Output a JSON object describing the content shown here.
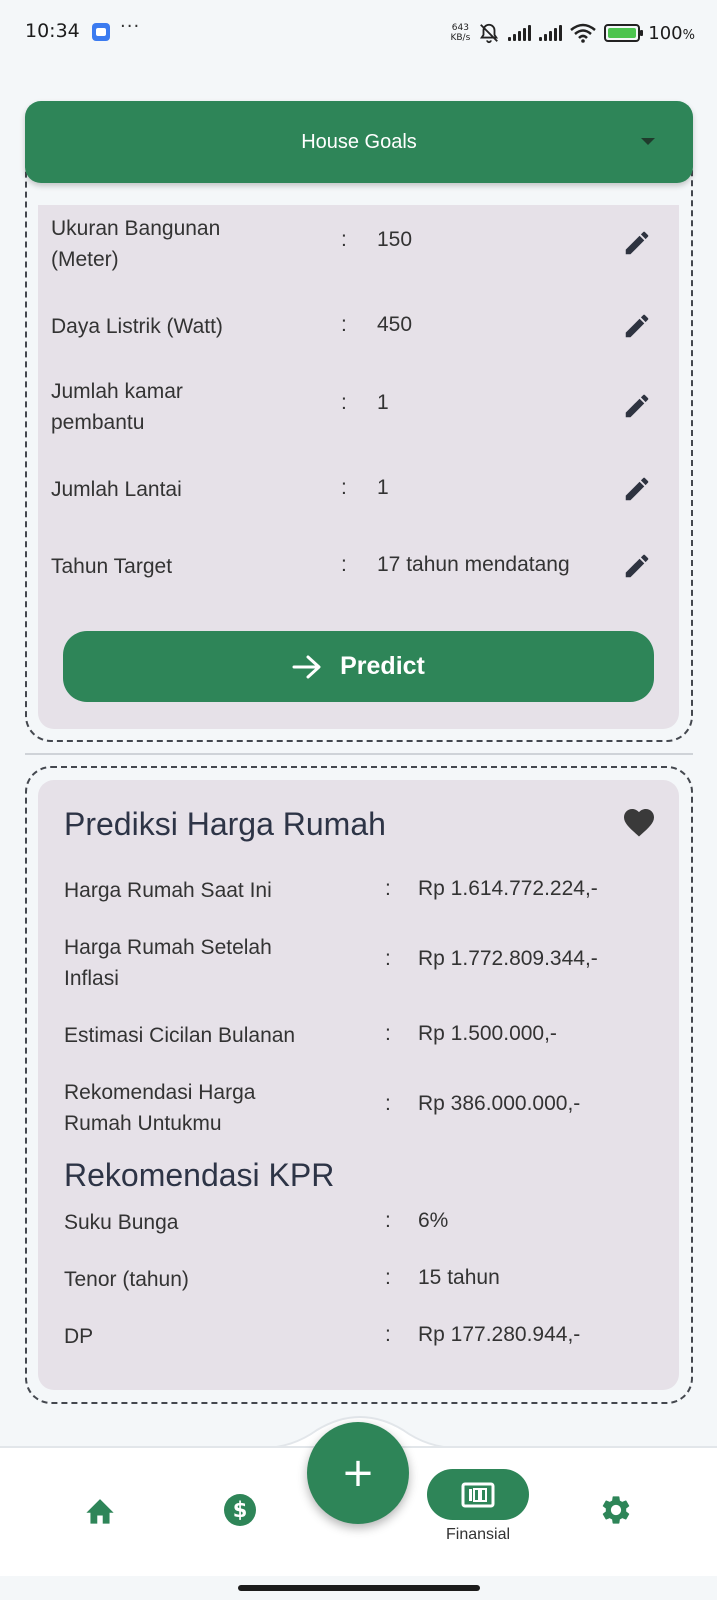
{
  "status_bar": {
    "time": "10:34",
    "dots": "···",
    "net_speed_value": "643",
    "net_speed_unit": "KB/s",
    "battery_percent": "100",
    "battery_suffix": "%"
  },
  "header": {
    "title": "House Goals"
  },
  "input_form": {
    "fields": [
      {
        "label": "Ukuran Bangunan (Meter)",
        "value": "150"
      },
      {
        "label": "Daya Listrik (Watt)",
        "value": "450"
      },
      {
        "label": "Jumlah kamar pembantu",
        "value": "1"
      },
      {
        "label": "Jumlah Lantai",
        "value": "1"
      },
      {
        "label": "Tahun Target",
        "value": "17 tahun mendatang"
      }
    ],
    "colon": ":",
    "predict_label": "Predict"
  },
  "prediction": {
    "title": "Prediksi Harga Rumah",
    "rows": [
      {
        "label": "Harga Rumah Saat Ini",
        "value": "Rp 1.614.772.224,-"
      },
      {
        "label": "Harga Rumah Setelah Inflasi",
        "value": "Rp 1.772.809.344,-"
      },
      {
        "label": "Estimasi Cicilan Bulanan",
        "value": "Rp 1.500.000,-"
      },
      {
        "label": "Rekomendasi Harga Rumah Untukmu",
        "value": "Rp 386.000.000,-"
      }
    ]
  },
  "kpr": {
    "title": "Rekomendasi KPR",
    "rows": [
      {
        "label": "Suku Bunga",
        "value": "6%"
      },
      {
        "label": "Tenor (tahun)",
        "value": "15 tahun"
      },
      {
        "label": "DP",
        "value": "Rp 177.280.944,-"
      }
    ]
  },
  "bottom_nav": {
    "items": [
      {
        "icon": "home-icon"
      },
      {
        "icon": "dollar-icon"
      },
      {
        "icon": "add-icon"
      },
      {
        "icon": "finance-icon",
        "label": "Finansial"
      },
      {
        "icon": "settings-icon"
      }
    ],
    "fab_symbol": "+",
    "active_label": "Finansial"
  },
  "colors": {
    "primary": "#2e8558",
    "card_bg": "#e6e1e8",
    "page_bg": "#f4f7f9",
    "heading": "#2d3446"
  }
}
